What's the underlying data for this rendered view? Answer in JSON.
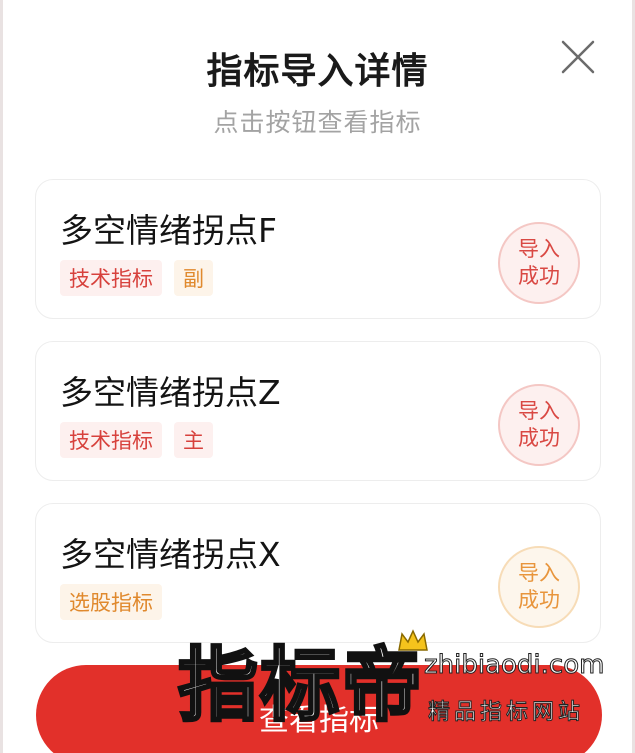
{
  "dialog": {
    "title": "指标导入详情",
    "subtitle": "点击按钮查看指标",
    "close_icon": "close-icon"
  },
  "indicators": [
    {
      "name": "多空情绪拐点F",
      "tags": [
        "技术指标",
        "副"
      ],
      "status": [
        "导入",
        "成功"
      ],
      "color": "red"
    },
    {
      "name": "多空情绪拐点Z",
      "tags": [
        "技术指标",
        "主"
      ],
      "status": [
        "导入",
        "成功"
      ],
      "color": "red"
    },
    {
      "name": "多空情绪拐点X",
      "tags": [
        "选股指标"
      ],
      "status": [
        "导入",
        "成功"
      ],
      "color": "orange"
    }
  ],
  "footer": {
    "button_label": "查看指标"
  },
  "watermark": {
    "title": "指标帝",
    "url": "zhibiaodi.com",
    "tagline": "精品指标网站"
  },
  "colors": {
    "accent_red": "#e2302a",
    "tag_red": "#d7413c",
    "tag_orange": "#e0892d"
  }
}
